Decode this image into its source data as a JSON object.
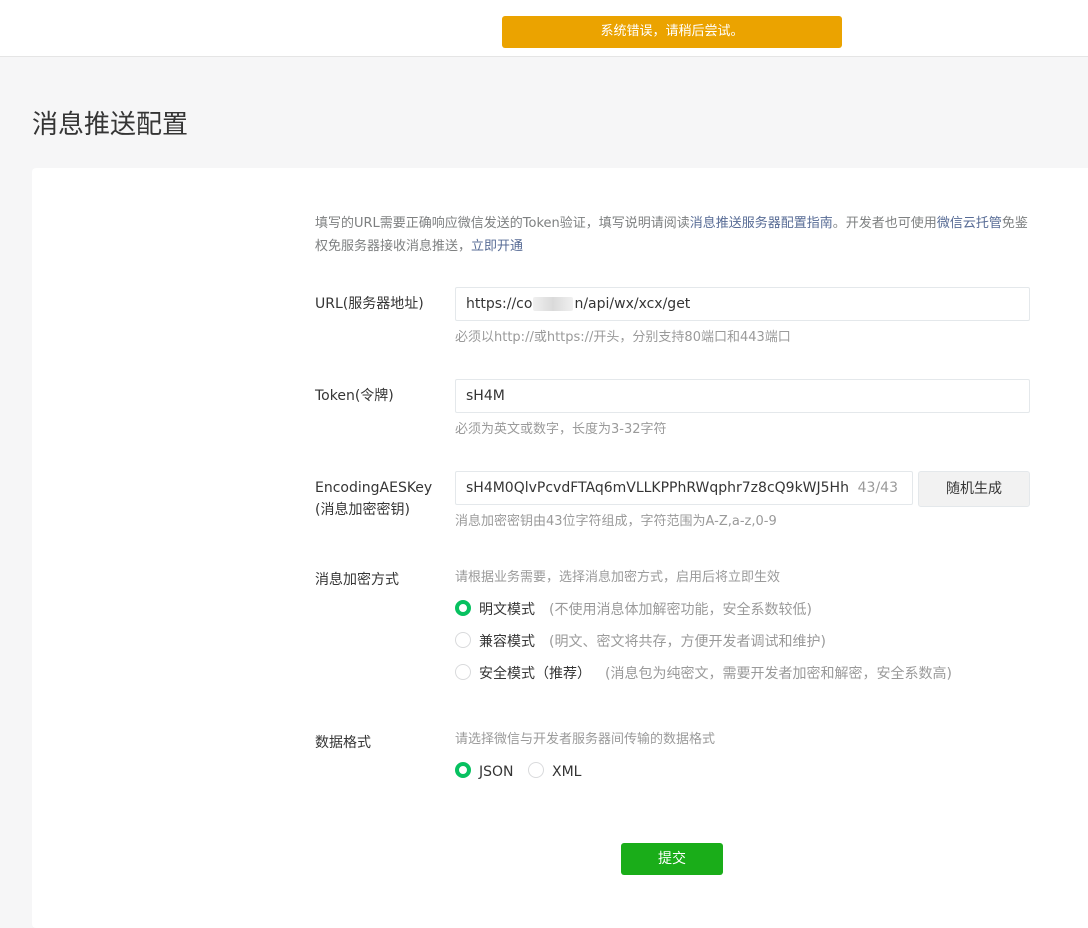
{
  "toast": {
    "text": "系统错误，请稍后尝试。",
    "color": "#eba300"
  },
  "page": {
    "title": "消息推送配置"
  },
  "description": {
    "part1": "填写的URL需要正确响应微信发送的Token验证，填写说明请阅读",
    "link1": "消息推送服务器配置指南",
    "part2": "。开发者也可使用",
    "link2": "微信云托管",
    "part3": "免鉴权免服务器接收消息推送，",
    "link3": "立即开通"
  },
  "form": {
    "url": {
      "label": "URL(服务器地址)",
      "value_prefix": "https://co",
      "value_suffix": "n/api/wx/xcx/get",
      "hint": "必须以http://或https://开头，分别支持80端口和443端口"
    },
    "token": {
      "label": "Token(令牌)",
      "value": "sH4M",
      "hint": "必须为英文或数字，长度为3-32字符"
    },
    "aeskey": {
      "label_line1": "EncodingAESKey",
      "label_line2": "(消息加密密钥)",
      "value": "sH4M0QlvPcvdFTAq6mVLLKPPhRWqphr7z8cQ9kWJ5Hh",
      "counter": "43/43",
      "generate_label": "随机生成",
      "hint": "消息加密密钥由43位字符组成，字符范围为A-Z,a-z,0-9"
    },
    "encryption": {
      "label": "消息加密方式",
      "hint": "请根据业务需要，选择消息加密方式，启用后将立即生效",
      "options": [
        {
          "label": "明文模式",
          "note": "(不使用消息体加解密功能，安全系数较低)",
          "selected": true
        },
        {
          "label": "兼容模式",
          "note": "(明文、密文将共存，方便开发者调试和维护)",
          "selected": false
        },
        {
          "label": "安全模式（推荐）",
          "note": "(消息包为纯密文，需要开发者加密和解密，安全系数高)",
          "selected": false
        }
      ]
    },
    "format": {
      "label": "数据格式",
      "hint": "请选择微信与开发者服务器间传输的数据格式",
      "options": [
        {
          "label": "JSON",
          "selected": true
        },
        {
          "label": "XML",
          "selected": false
        }
      ]
    },
    "submit_label": "提交"
  },
  "colors": {
    "primary": "#07c160",
    "submit": "#1aad19",
    "link": "#576b95"
  }
}
